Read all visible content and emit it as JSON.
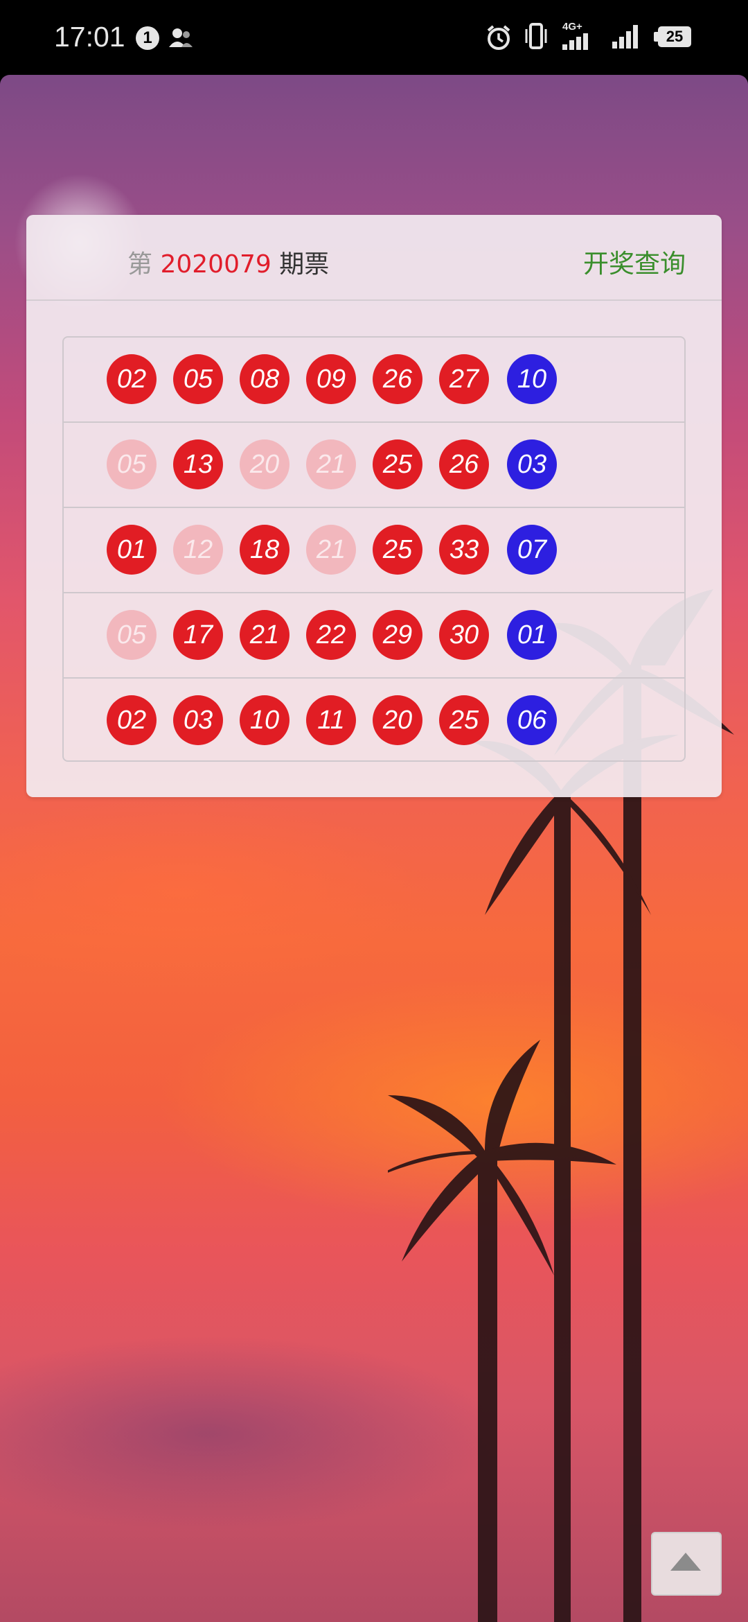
{
  "status_bar": {
    "time": "17:01",
    "notification_count": "1",
    "battery": "25",
    "network": "4G+"
  },
  "card": {
    "prefix": "第",
    "period_number": "2020079",
    "suffix": "期票",
    "query_link": "开奖查询"
  },
  "tickets": [
    {
      "balls": [
        {
          "n": "02",
          "state": "red"
        },
        {
          "n": "05",
          "state": "red"
        },
        {
          "n": "08",
          "state": "red"
        },
        {
          "n": "09",
          "state": "red"
        },
        {
          "n": "26",
          "state": "red"
        },
        {
          "n": "27",
          "state": "red"
        },
        {
          "n": "10",
          "state": "blue"
        }
      ]
    },
    {
      "balls": [
        {
          "n": "05",
          "state": "faded"
        },
        {
          "n": "13",
          "state": "red"
        },
        {
          "n": "20",
          "state": "faded"
        },
        {
          "n": "21",
          "state": "faded"
        },
        {
          "n": "25",
          "state": "red"
        },
        {
          "n": "26",
          "state": "red"
        },
        {
          "n": "03",
          "state": "blue"
        }
      ]
    },
    {
      "balls": [
        {
          "n": "01",
          "state": "red"
        },
        {
          "n": "12",
          "state": "faded"
        },
        {
          "n": "18",
          "state": "red"
        },
        {
          "n": "21",
          "state": "faded"
        },
        {
          "n": "25",
          "state": "red"
        },
        {
          "n": "33",
          "state": "red"
        },
        {
          "n": "07",
          "state": "blue"
        }
      ]
    },
    {
      "balls": [
        {
          "n": "05",
          "state": "faded"
        },
        {
          "n": "17",
          "state": "red"
        },
        {
          "n": "21",
          "state": "red"
        },
        {
          "n": "22",
          "state": "red"
        },
        {
          "n": "29",
          "state": "red"
        },
        {
          "n": "30",
          "state": "red"
        },
        {
          "n": "01",
          "state": "blue"
        }
      ]
    },
    {
      "balls": [
        {
          "n": "02",
          "state": "red"
        },
        {
          "n": "03",
          "state": "red"
        },
        {
          "n": "10",
          "state": "red"
        },
        {
          "n": "11",
          "state": "red"
        },
        {
          "n": "20",
          "state": "red"
        },
        {
          "n": "25",
          "state": "red"
        },
        {
          "n": "06",
          "state": "blue"
        }
      ]
    }
  ],
  "colors": {
    "red_ball": "#e11d24",
    "faded_ball": "#f2b7bd",
    "blue_ball": "#2d1fe0",
    "period_number": "#e11d2b",
    "query_link": "#3a8e2c"
  },
  "icons": {
    "back_to_top": "triangle-up-icon",
    "alarm": "alarm-icon",
    "vibrate": "vibrate-icon"
  }
}
